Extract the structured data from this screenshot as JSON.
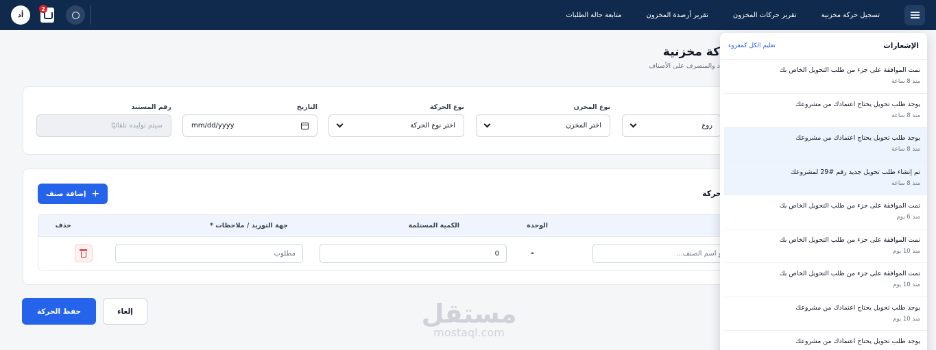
{
  "topbar": {
    "nav": [
      "تسجيل حركة مخزنية",
      "تقرير حركات المخزون",
      "تقرير أرصدة المخزون",
      "متابعة حالة الطلبات"
    ],
    "notif_count": "2",
    "avatar_initials": "أد"
  },
  "page": {
    "title": "كة مخزنية",
    "subtitle": "د والمنصرف على الأصناف"
  },
  "header_form": {
    "first_select_value": "روع",
    "warehouse_type_label": "نوع المخزن",
    "warehouse_type_value": "اختر المخزن",
    "movement_type_label": "نوع الحركة",
    "movement_type_value": "اختر نوع الحركة",
    "date_label": "التاريخ",
    "date_placeholder": "mm/dd/yyyy",
    "doc_number_label": "رقم المستند",
    "doc_number_placeholder": "سيتم توليده تلقائيًا"
  },
  "items_section": {
    "title": "حركة",
    "add_item_label": "إضافة صنف",
    "columns": {
      "unit": "الوحدة",
      "received_qty": "الكمية المستلمة",
      "supplier_notes": "جهة التوريد / ملاحظات *",
      "delete": "حذف"
    },
    "row": {
      "item_search_placeholder": "د أو اسم الصنف...",
      "unit": "-",
      "quantity": "0",
      "notes_placeholder": "مطلوب"
    }
  },
  "actions": {
    "save_label": "حفظ الحركة",
    "cancel_label": "إلغاء"
  },
  "watermark": {
    "arabic": "مستقل",
    "latin": "mostaql.com"
  },
  "notifications": {
    "title": "الإشعارات",
    "mark_all_read": "تعليم الكل كمقروء",
    "items": [
      {
        "text": "تمت الموافقة على جزء من طلب التحويل الخاص بك",
        "time": "منذ 8 ساعة",
        "unread": false
      },
      {
        "text": "يوجد طلب تحويل يحتاج اعتمادك من مشروعك",
        "time": "منذ 8 ساعة",
        "unread": false
      },
      {
        "text": "يوجد طلب تحويل يحتاج اعتمادك من مشروعك",
        "time": "منذ 8 ساعة",
        "unread": true
      },
      {
        "text": "تم إنشاء طلب تحويل جديد رقم #29 لمشروعك",
        "time": "منذ 8 ساعة",
        "unread": true
      },
      {
        "text": "تمت الموافقة على جزء من طلب التحويل الخاص بك",
        "time": "منذ 6 يوم",
        "unread": false
      },
      {
        "text": "تمت الموافقة على جزء من طلب التحويل الخاص بك",
        "time": "منذ 10 يوم",
        "unread": false
      },
      {
        "text": "تمت الموافقة على جزء من طلب التحويل الخاص بك",
        "time": "منذ 10 يوم",
        "unread": false
      },
      {
        "text": "يوجد طلب تحويل يحتاج اعتمادك من مشروعك",
        "time": "منذ 10 يوم",
        "unread": false
      },
      {
        "text": "يوجد طلب تحويل يحتاج اعتمادك من مشروعك",
        "time": "",
        "unread": false
      }
    ]
  },
  "colors": {
    "topbar": "#0f2a4d",
    "primary": "#2563eb",
    "danger": "#dc2626",
    "unread_bg": "#eef4fd"
  }
}
